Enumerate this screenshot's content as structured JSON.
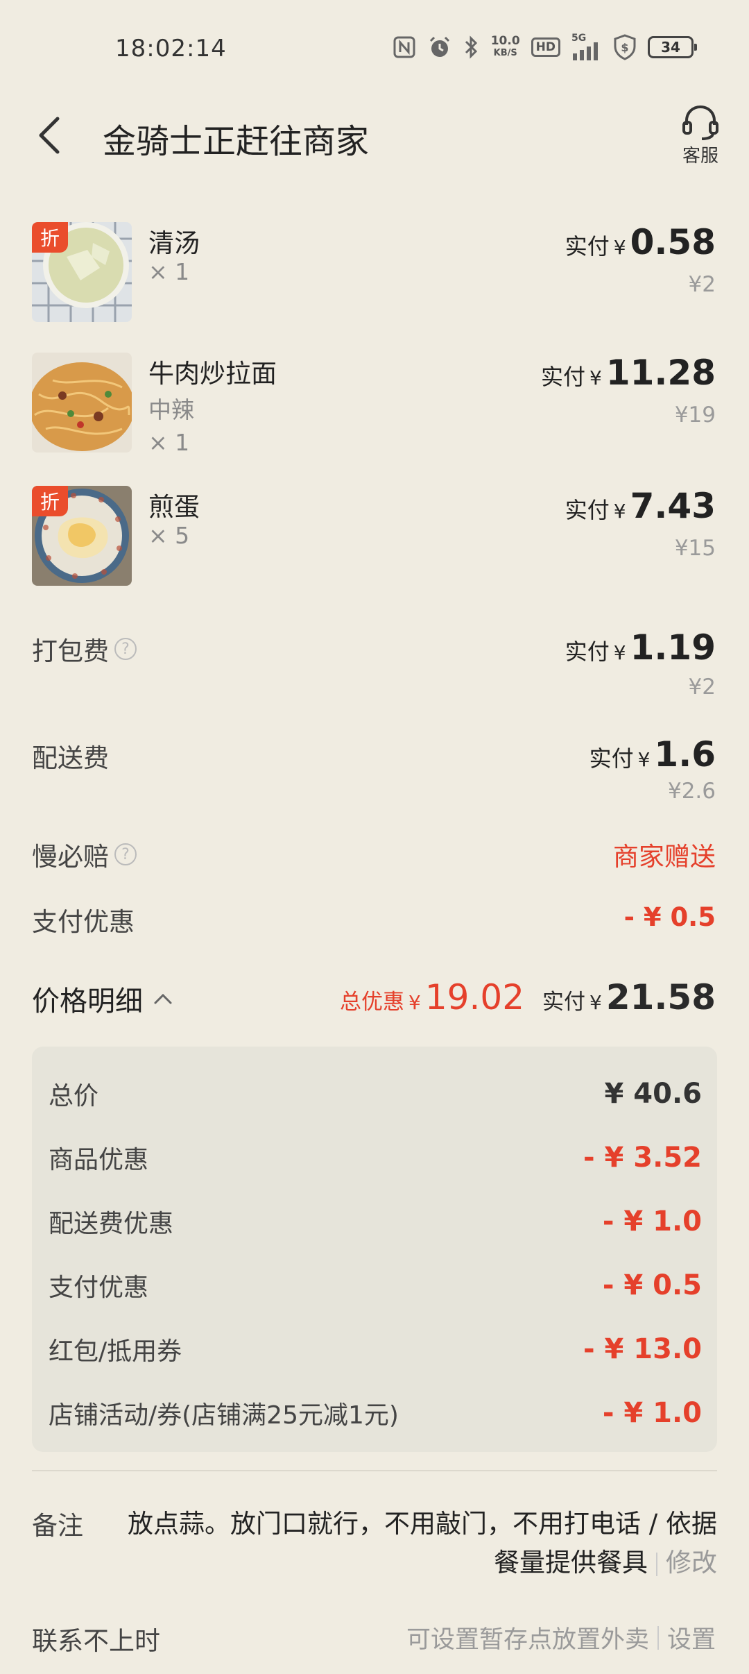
{
  "status_bar": {
    "time": "18:02:14",
    "net_speed_value": "10.0",
    "net_speed_unit": "KB/S",
    "hd_label": "HD",
    "signal_label": "5G",
    "battery": "34"
  },
  "header": {
    "title": "金骑士正赶往商家",
    "service_label": "客服"
  },
  "items": [
    {
      "badge": "折",
      "name": "清汤",
      "spec": "",
      "qty": "× 1",
      "paid_label": "实付",
      "currency": "¥",
      "paid": "0.58",
      "original": "¥2"
    },
    {
      "badge": "",
      "name": "牛肉炒拉面",
      "spec": "中辣",
      "qty": "× 1",
      "paid_label": "实付",
      "currency": "¥",
      "paid": "11.28",
      "original": "¥19"
    },
    {
      "badge": "折",
      "name": "煎蛋",
      "spec": "",
      "qty": "× 5",
      "paid_label": "实付",
      "currency": "¥",
      "paid": "7.43",
      "original": "¥15"
    }
  ],
  "fees": {
    "packing": {
      "label": "打包费",
      "paid_label": "实付",
      "currency": "¥",
      "paid": "1.19",
      "original": "¥2"
    },
    "delivery": {
      "label": "配送费",
      "paid_label": "实付",
      "currency": "¥",
      "paid": "1.6",
      "original": "¥2.6"
    },
    "late_comp": {
      "label": "慢必赔",
      "value": "商家赠送"
    },
    "pay_discount": {
      "label": "支付优惠",
      "value": "- ¥ 0.5"
    }
  },
  "price_detail": {
    "title": "价格明细",
    "total_discount_label": "总优惠",
    "total_discount_currency": "¥",
    "total_discount": "19.02",
    "paid_label": "实付",
    "paid_currency": "¥",
    "paid": "21.58",
    "rows": [
      {
        "label": "总价",
        "value": "¥ 40.6"
      },
      {
        "label": "商品优惠",
        "value": "- ¥ 3.52"
      },
      {
        "label": "配送费优惠",
        "value": "- ¥ 1.0"
      },
      {
        "label": "支付优惠",
        "value": "- ¥ 0.5"
      },
      {
        "label": "红包/抵用券",
        "value": "- ¥ 13.0"
      },
      {
        "label": "店铺活动/券(店铺满25元减1元)",
        "value": "- ¥ 1.0"
      }
    ]
  },
  "note": {
    "label": "备注",
    "line1": "放点蒜。放门口就行，不用敲门，不用打电话 / 依据",
    "line2": "餐量提供餐具",
    "edit": "修改"
  },
  "contact": {
    "label": "联系不上时",
    "hint": "可设置暂存点放置外卖",
    "action": "设置"
  },
  "colors": {
    "background": "#f0ece1",
    "accent_red": "#e5402b",
    "detail_box": "#e6e4da"
  }
}
